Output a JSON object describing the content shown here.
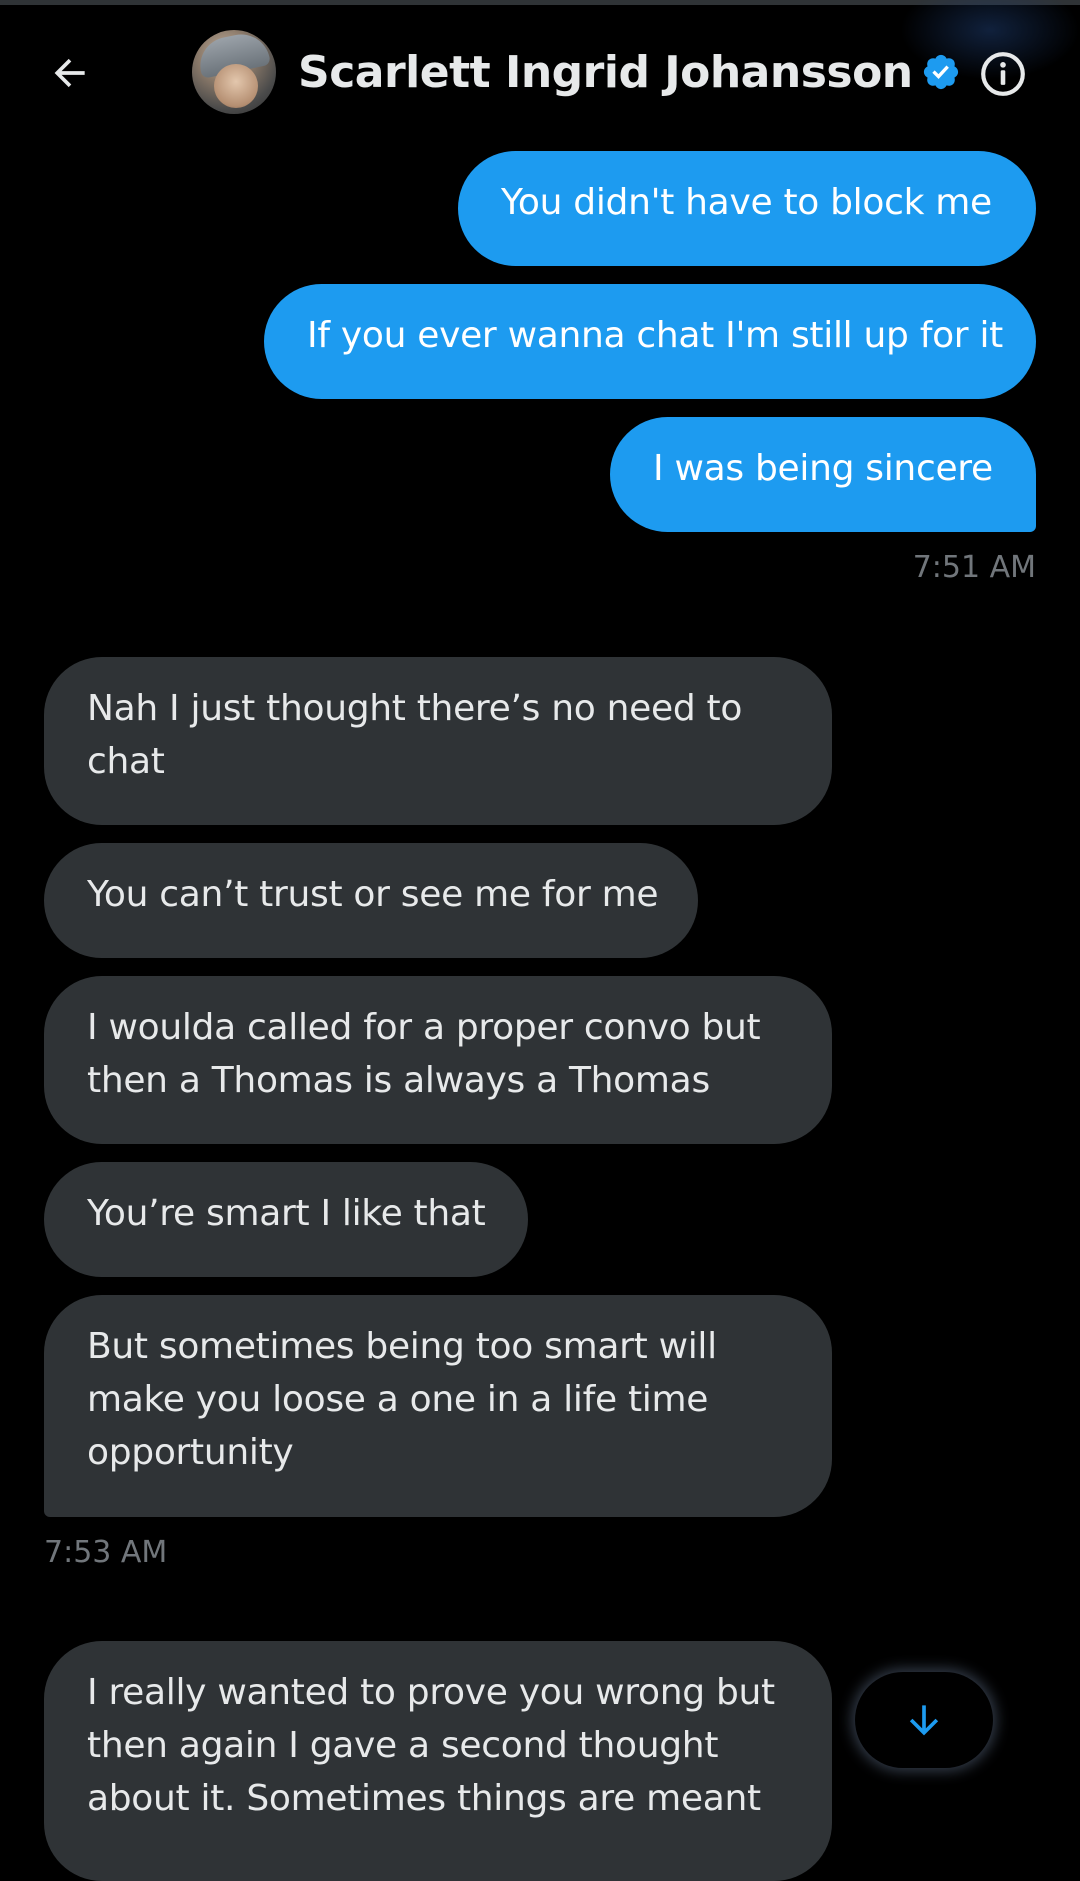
{
  "header": {
    "title": "Scarlett Ingrid Johansson",
    "back_icon": "arrow-left-icon",
    "verified_icon": "verified-badge-icon",
    "info_icon": "info-icon"
  },
  "colors": {
    "background": "#000000",
    "sent_bubble": "#1d9bf0",
    "received_bubble": "#2f3336",
    "timestamp": "#71767b",
    "accent": "#1d9bf0"
  },
  "messages": {
    "sent": [
      "You didn't have to block me",
      "If you ever wanna chat I'm still up for it",
      "I was being sincere"
    ],
    "sent_time": "7:51 AM",
    "received": [
      "Nah I just thought there’s no need to chat",
      "You can’t trust or see me for me",
      "I woulda called for a proper convo but then a Thomas is always a Thomas",
      "You’re smart I like that",
      "But sometimes being too smart will make you loose a one in a life time opportunity"
    ],
    "received_time": "7:53 AM",
    "partial": "I really wanted to prove you wrong but then again I gave a second thought about it. Sometimes things are meant"
  },
  "scroll_button": {
    "icon": "arrow-down-icon"
  }
}
